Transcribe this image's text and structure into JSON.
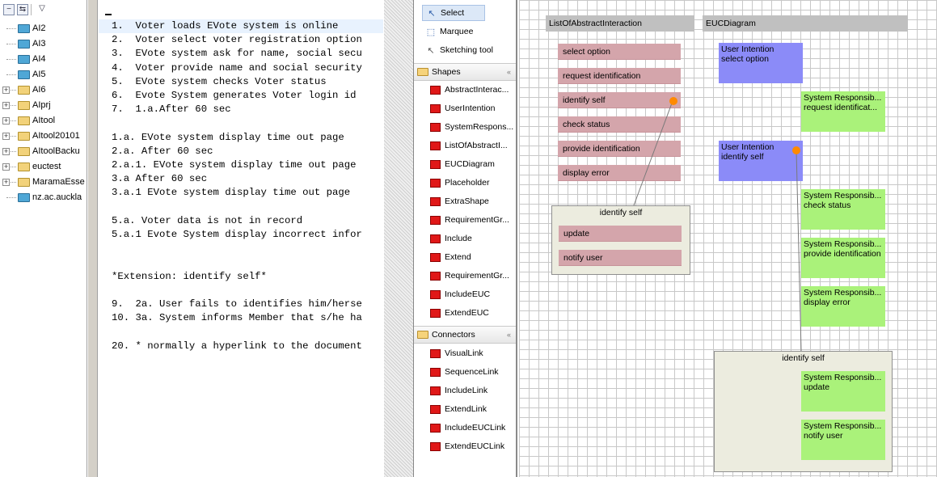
{
  "tree": {
    "items": [
      {
        "label": "AI2",
        "kind": "package",
        "expander": ""
      },
      {
        "label": "AI3",
        "kind": "package",
        "expander": ""
      },
      {
        "label": "AI4",
        "kind": "package",
        "expander": ""
      },
      {
        "label": "AI5",
        "kind": "package",
        "expander": ""
      },
      {
        "label": "AI6",
        "kind": "project",
        "expander": "+"
      },
      {
        "label": "AIprj",
        "kind": "project",
        "expander": "+"
      },
      {
        "label": "AItool",
        "kind": "project",
        "expander": "+"
      },
      {
        "label": "AItool20101",
        "kind": "project",
        "expander": "+"
      },
      {
        "label": "AItoolBacku",
        "kind": "project",
        "expander": "+"
      },
      {
        "label": "euctest",
        "kind": "project",
        "expander": "+"
      },
      {
        "label": "MaramaEsse",
        "kind": "project",
        "expander": "+"
      },
      {
        "label": "nz.ac.auckla",
        "kind": "package",
        "expander": ""
      }
    ],
    "toolbar": {
      "collapse": "−",
      "link": "⇆",
      "menu": "▽"
    }
  },
  "editor": {
    "lines": [
      "1.  Voter loads EVote system is online",
      "2.  Voter select voter registration option",
      "3.  EVote system ask for name, social secu",
      "4.  Voter provide name and social security",
      "5.  EVote system checks Voter status",
      "6.  Evote System generates Voter login id",
      "7.  1.a.After 60 sec",
      "",
      "1.a. EVote system display time out page",
      "2.a. After 60 sec",
      "2.a.1. EVote system display time out page",
      "3.a After 60 sec",
      "3.a.1 EVote system display time out page",
      "",
      "5.a. Voter data is not in record",
      "5.a.1 Evote System display incorrect infor",
      "",
      "",
      "*Extension: identify self*",
      "",
      "9.  2a. User fails to identifies him/herse",
      "10. 3a. System informs Member that s/he ha",
      "",
      "20. * normally a hyperlink to the document"
    ],
    "scroll_up": "▲"
  },
  "palette": {
    "tools": [
      {
        "label": "Select",
        "icon": "arrow-cursor-icon",
        "glyph": "↖"
      },
      {
        "label": "Marquee",
        "icon": "marquee-icon",
        "glyph": "⬚"
      },
      {
        "label": "Sketching tool",
        "icon": "pencil-cursor-icon",
        "glyph": "↖"
      }
    ],
    "shapes_label": "Shapes",
    "shapes": [
      "AbstractInterac...",
      "UserIntention",
      "SystemRespons...",
      "ListOfAbstractI...",
      "EUCDiagram",
      "Placeholder",
      "ExtraShape",
      "RequirementGr...",
      "Include",
      "Extend",
      "RequirementGr...",
      "IncludeEUC",
      "ExtendEUC"
    ],
    "connectors_label": "Connectors",
    "connectors": [
      "VisualLink",
      "SequenceLink",
      "IncludeLink",
      "ExtendLink",
      "IncludeEUCLink",
      "ExtendEUCLink"
    ],
    "chevron": "«"
  },
  "canvas": {
    "list_header": "ListOfAbstractInteraction",
    "euc_header": "EUCDiagram",
    "interactions": [
      "select option",
      "request identification",
      "identify self",
      "check status",
      "provide identification",
      "display error"
    ],
    "list_container": {
      "title": "identify self",
      "items": [
        "update",
        "notify user"
      ]
    },
    "euc_blue": [
      {
        "title": "User Intention",
        "text": "select option"
      },
      {
        "title": "User Intention",
        "text": "identify self"
      }
    ],
    "euc_green": [
      {
        "title": "System Responsib...",
        "text": "request identificat..."
      },
      {
        "title": "System Responsib...",
        "text": "check status"
      },
      {
        "title": "System Responsib...",
        "text": "provide identification"
      },
      {
        "title": "System Responsib...",
        "text": "display error"
      }
    ],
    "euc_container": {
      "title": "identify self",
      "items": [
        {
          "title": "System Responsib...",
          "text": "update"
        },
        {
          "title": "System Responsib...",
          "text": "notify user"
        }
      ]
    },
    "colors": {
      "pink": "#d4a5ab",
      "blue": "#8b8bf8",
      "green": "#aaf27a",
      "anchor": "#ff8a00"
    }
  }
}
